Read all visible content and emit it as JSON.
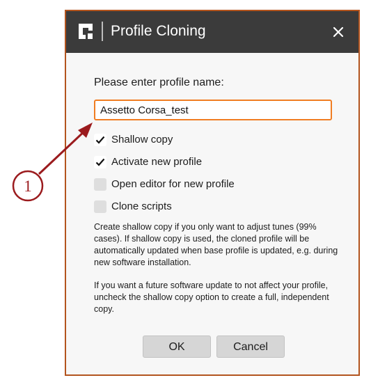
{
  "dialog": {
    "title": "Profile Cloning",
    "close_icon": "close-icon",
    "logo_icon": "app-logo-icon"
  },
  "form": {
    "prompt": "Please enter profile name:",
    "name_value": "Assetto Corsa_test"
  },
  "options": [
    {
      "label": "Shallow copy",
      "checked": true
    },
    {
      "label": "Activate new profile",
      "checked": true
    },
    {
      "label": "Open editor for new profile",
      "checked": false
    },
    {
      "label": "Clone scripts",
      "checked": false
    }
  ],
  "help": {
    "paragraph1": "Create shallow copy if you only want to adjust tunes (99% cases). If shallow copy is used, the cloned profile will be automatically updated when base profile is updated, e.g. during new software installation.",
    "paragraph2": "If you want a future software update to not affect your profile, uncheck the shallow copy option to create a full, independent copy."
  },
  "buttons": {
    "ok": "OK",
    "cancel": "Cancel"
  },
  "annotation": {
    "number": "1",
    "color": "#9b1b1e"
  },
  "colors": {
    "accent": "#f07d22",
    "titlebar": "#3b3b3b",
    "frame": "#b3541e"
  }
}
